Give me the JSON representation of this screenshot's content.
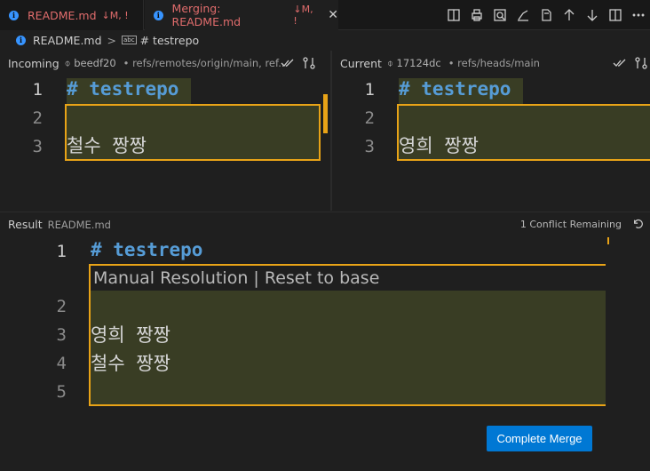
{
  "tabs": [
    {
      "title": "README.md",
      "status": "↓M, !",
      "info": "i"
    },
    {
      "title": "Merging: README.md",
      "status": "↓M, !",
      "info": "i",
      "close": "✕"
    }
  ],
  "breadcrumb": {
    "file": "README.md",
    "sep": ">",
    "symbol_tag": "abc",
    "symbol": "# testrepo"
  },
  "incoming": {
    "label": "Incoming",
    "hash": "beedf20",
    "ref": "• refs/remotes/origin/main, ref...",
    "lines": [
      "# testrepo",
      "",
      "철수 짱짱"
    ],
    "line_numbers": [
      "1",
      "2",
      "3"
    ]
  },
  "current": {
    "label": "Current",
    "hash": "17124dc",
    "ref": "• refs/heads/main",
    "lines": [
      "# testrepo",
      "",
      "영희 짱짱"
    ],
    "line_numbers": [
      "1",
      "2",
      "3"
    ]
  },
  "result": {
    "label": "Result",
    "file": "README.md",
    "conflicts": "1 Conflict Remaining",
    "codelens": {
      "manual": "Manual Resolution",
      "sep": "|",
      "reset": "Reset to base"
    },
    "lines": [
      "# testrepo",
      "",
      "영희 짱짱",
      "철수 짱짱",
      ""
    ],
    "line_numbers": [
      "1",
      "2",
      "3",
      "4",
      "5"
    ]
  },
  "complete_button": "Complete Merge",
  "colors": {
    "accent": "#0078d4",
    "conflict": "#e8a317",
    "highlight": "#393d24",
    "heading": "#569cd6"
  }
}
